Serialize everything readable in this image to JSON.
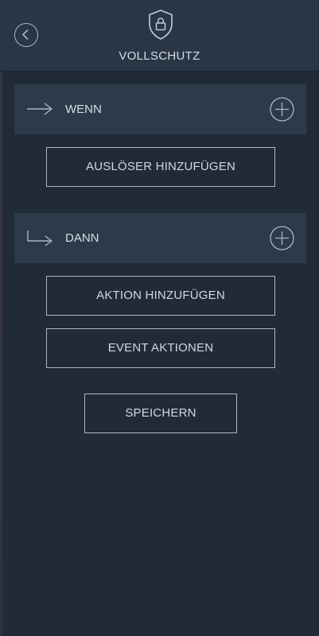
{
  "header": {
    "title": "VOLLSCHUTZ",
    "back_icon": "chevron-left-icon",
    "shield_icon": "shield-lock-icon"
  },
  "when_section": {
    "label": "WENN",
    "arrow_icon": "arrow-right-icon",
    "add_icon": "plus-circle-icon",
    "button_label": "AUSLÖSER HINZUFÜGEN"
  },
  "then_section": {
    "label": "DANN",
    "arrow_icon": "arrow-turn-right-icon",
    "add_icon": "plus-circle-icon",
    "add_action_label": "AKTION HINZUFÜGEN",
    "event_actions_label": "EVENT AKTIONEN"
  },
  "save_label": "SPEICHERN",
  "colors": {
    "background": "#212b37",
    "header": "#2a3645",
    "section": "#2c3a4a",
    "outline": "#aeb8c3",
    "text": "#d6dde5"
  }
}
